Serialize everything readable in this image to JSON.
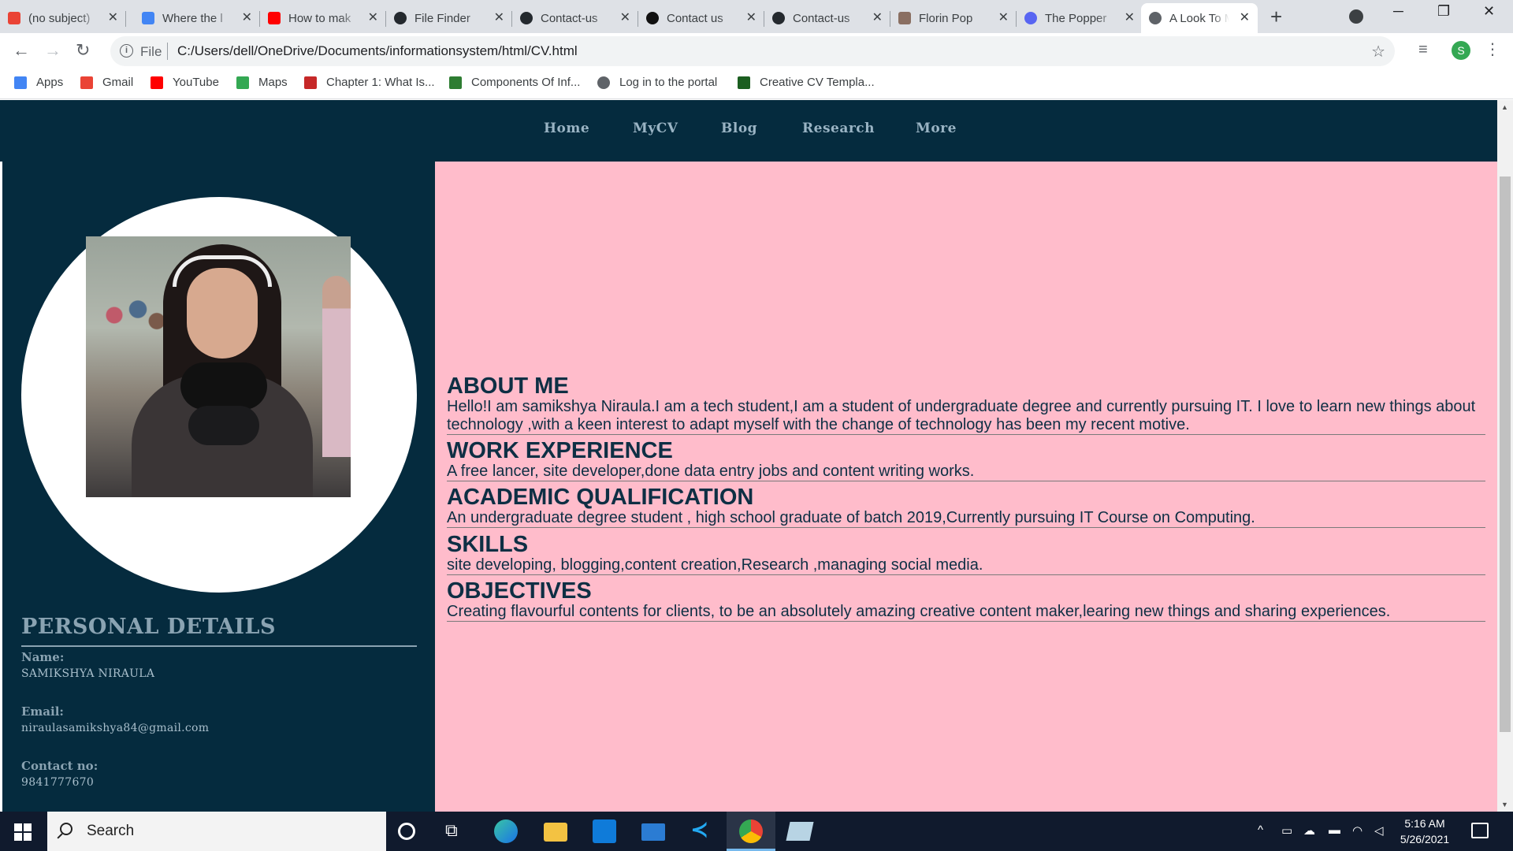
{
  "browser": {
    "tabs": [
      {
        "title": "(no subject)",
        "icon": "gmail-icon",
        "color": "#ea4335"
      },
      {
        "title": "Where the l",
        "icon": "google-icon",
        "color": "#4285f4"
      },
      {
        "title": "How to mak",
        "icon": "youtube-icon",
        "color": "#ff0000"
      },
      {
        "title": "File Finder",
        "icon": "github-icon",
        "color": "#24292e"
      },
      {
        "title": "Contact-us",
        "icon": "github-icon",
        "color": "#24292e"
      },
      {
        "title": "Contact us",
        "icon": "codepen-icon",
        "color": "#111111"
      },
      {
        "title": "Contact-us",
        "icon": "github-icon",
        "color": "#24292e"
      },
      {
        "title": "Florin Pop",
        "icon": "avatar-icon",
        "color": "#8a6f62"
      },
      {
        "title": "The Popper",
        "icon": "discord-icon",
        "color": "#5865f2"
      },
      {
        "title": "A Look To M",
        "icon": "globe-icon",
        "color": "#5f6368"
      }
    ],
    "address": {
      "scheme_label": "File",
      "url": "C:/Users/dell/OneDrive/Documents/informationsystem/html/CV.html"
    },
    "profile_initial": "S",
    "bookmarks": [
      {
        "label": "Apps",
        "icon": "apps-grid-icon",
        "color": "#4285f4"
      },
      {
        "label": "Gmail",
        "icon": "gmail-icon",
        "color": "#ea4335"
      },
      {
        "label": "YouTube",
        "icon": "youtube-icon",
        "color": "#ff0000"
      },
      {
        "label": "Maps",
        "icon": "maps-icon",
        "color": "#34a853"
      },
      {
        "label": "Chapter 1: What Is...",
        "icon": "pb-icon",
        "color": "#c62828"
      },
      {
        "label": "Components Of Inf...",
        "icon": "link-icon",
        "color": "#2e7d32"
      },
      {
        "label": "Log in to the portal",
        "icon": "globe-icon",
        "color": "#5f6368"
      },
      {
        "label": "Creative CV Templa...",
        "icon": "template-icon",
        "color": "#1b5e20"
      }
    ]
  },
  "site": {
    "nav": [
      "Home",
      "MyCV",
      "Blog",
      "Research",
      "More"
    ],
    "personal": {
      "heading": "PERSONAL DETAILS",
      "name_label": "Name:",
      "name": "SAMIKSHYA NIRAULA",
      "email_label": "Email:",
      "email": "niraulasamikshya84@gmail.com",
      "contact_label": "Contact no:",
      "contact": "9841777670"
    },
    "sections": [
      {
        "heading": "ABOUT ME",
        "text": "Hello!I am samikshya Niraula.I am a tech student,I am a student of undergraduate degree and currently pursuing IT. I love to learn new things about technology ,with a keen interest to adapt myself with the change of technology has been my recent motive."
      },
      {
        "heading": "WORK EXPERIENCE",
        "text": "A free lancer, site developer,done data entry jobs and content writing works."
      },
      {
        "heading": "ACADEMIC QUALIFICATION",
        "text": "An undergraduate degree student , high school graduate of batch 2019,Currently pursuing IT Course on Computing."
      },
      {
        "heading": "SKILLS",
        "text": "site developing, blogging,content creation,Research ,managing social media."
      },
      {
        "heading": "OBJECTIVES",
        "text": "Creating flavourful contents for clients, to be an absolutely amazing creative content maker,learing new things and sharing experiences."
      }
    ],
    "colors": {
      "nav_bg": "#052b3e",
      "content_bg": "#ffbccb",
      "heading": "#0e2f44"
    }
  },
  "taskbar": {
    "search_placeholder": "Search",
    "time": "5:16 AM",
    "date": "5/26/2021"
  }
}
